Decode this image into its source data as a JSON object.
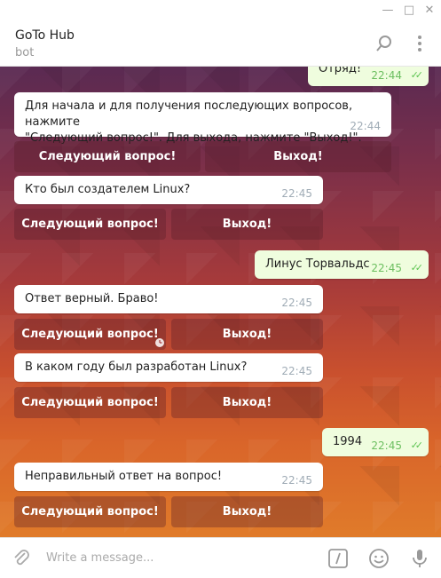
{
  "window": {
    "minimize": "—",
    "maximize": "□",
    "close": "✕"
  },
  "header": {
    "title": "GoTo Hub",
    "subtitle": "bot"
  },
  "messages": [
    {
      "text": "Отряд!",
      "time": "22:44",
      "dir": "out"
    },
    {
      "text": "Для начала и для получения последующих вопросов, нажмите\n\"Следующий вопрос!\". Для выхода, нажмите \"Выход!\".",
      "time": "22:44",
      "dir": "in"
    },
    {
      "text": "Кто был создателем Linux?",
      "time": "22:45",
      "dir": "in"
    },
    {
      "text": "Линус Торвальдс",
      "time": "22:45",
      "dir": "out"
    },
    {
      "text": "Ответ верный. Браво!",
      "time": "22:45",
      "dir": "in"
    },
    {
      "text": "В каком году был разработан Linux?",
      "time": "22:45",
      "dir": "in"
    },
    {
      "text": "1994",
      "time": "22:45",
      "dir": "out"
    },
    {
      "text": "Неправильный ответ на вопрос!",
      "time": "22:45",
      "dir": "in"
    }
  ],
  "keyboard": {
    "next": "Следующий вопрос!",
    "exit": "Выход!"
  },
  "composer": {
    "placeholder": "Write a message..."
  },
  "icons": [
    "minimize-icon",
    "maximize-icon",
    "close-icon",
    "search-icon",
    "more-vertical-icon",
    "attach-icon",
    "bot-command-icon",
    "emoji-icon",
    "microphone-icon"
  ]
}
